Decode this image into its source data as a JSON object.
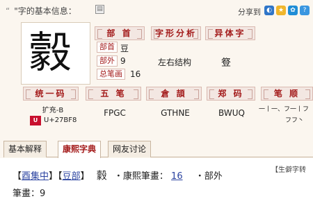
{
  "header": {
    "title_quote": "“",
    "title": "\"字的基本信息：",
    "share_label": "分享到",
    "share_icons": [
      "qzone-icon",
      "star-icon",
      "paw-icon",
      "help-icon"
    ]
  },
  "character": "豰",
  "radical_section": {
    "title": "部 首",
    "labels": {
      "radical": "部首",
      "outside": "部外",
      "total": "总笔画"
    },
    "values": {
      "radical": "豆",
      "outside": "9",
      "total": "16"
    }
  },
  "structure_section": {
    "title": "字形分析",
    "value": "左右结构"
  },
  "variant_section": {
    "title": "异体字",
    "value": "豋"
  },
  "codes": [
    {
      "title": "统一码",
      "value_line1": "扩充-B",
      "value_line2": "U+27BF8"
    },
    {
      "title": "五 笔",
      "value": "FPGC"
    },
    {
      "title": "倉 頡",
      "value": "GTHNE"
    },
    {
      "title": "郑 码",
      "value": "BWUQ"
    },
    {
      "title": "笔 顺",
      "value_line1": "一丨一、フ一丨フ",
      "value_line2": "フフ丶"
    }
  ],
  "tabs": [
    {
      "label": "基本解释",
      "active": false
    },
    {
      "label": "康熙字典",
      "active": true
    },
    {
      "label": "网友讨论",
      "active": false
    }
  ],
  "kangxi": {
    "bracket_open": "【",
    "bracket_close": "】",
    "ji": "酉集中",
    "bu": "豆部",
    "char": "豰",
    "stroke_label": "・康熙筆畫：",
    "stroke_value": "16",
    "outside_label": "・部外",
    "outside_value_label": "筆畫：",
    "outside_value": "9",
    "side_note": "【生僻字转"
  }
}
